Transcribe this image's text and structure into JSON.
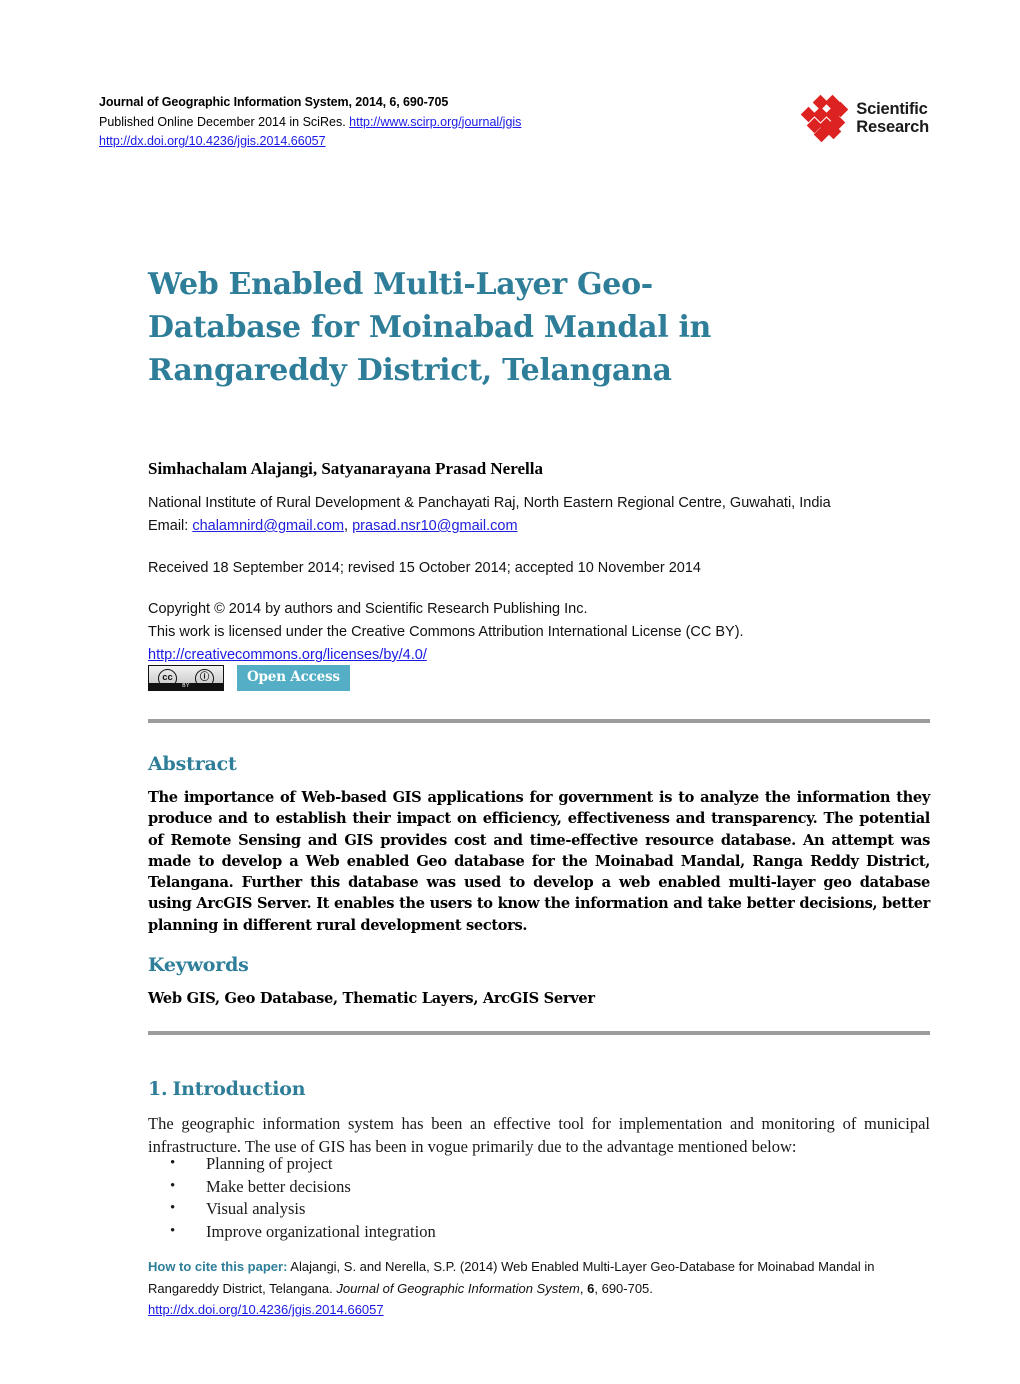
{
  "masthead": {
    "journal_line": "Journal of Geographic Information System, 2014, 6, 690-705",
    "published_prefix": "Published Online December 2014 in SciRes. ",
    "published_url": "http://www.scirp.org/journal/jgis",
    "doi_url": "http://dx.doi.org/10.4236/jgis.2014.66057",
    "logo_line1": "Scientific",
    "logo_line2": "Research",
    "logo_color": "#dd2222"
  },
  "paper": {
    "title": "Web Enabled Multi-Layer Geo-Database for Moinabad Mandal in Rangareddy District, Telangana",
    "title_color": "#2e7e99",
    "authors": "Simhachalam Alajangi, Satyanarayana Prasad Nerella",
    "affiliation": "National Institute of Rural Development & Panchayati Raj, North Eastern Regional Centre, Guwahati, India",
    "email_label": "Email: ",
    "email1": "chalamnird@gmail.com",
    "email_sep": ", ",
    "email2": "prasad.nsr10@gmail.com",
    "received": "Received 18 September 2014; revised 15 October 2014; accepted 10 November 2014",
    "copyright_line1": "Copyright © 2014 by authors and Scientific Research Publishing Inc.",
    "copyright_line2": "This work is licensed under the Creative Commons Attribution International License (CC BY).",
    "license_url": "http://creativecommons.org/licenses/by/4.0/"
  },
  "badges": {
    "cc_mark": "cc",
    "cc_by_person": "ⓘ",
    "cc_by_label": "BY",
    "open_access": "Open Access",
    "open_access_color": "#54afc6"
  },
  "abstract": {
    "heading": "Abstract",
    "text": "The importance of Web-based GIS applications for government is to analyze the information they produce and to establish their impact on efficiency, effectiveness and transparency. The potential of Remote Sensing and GIS provides cost and time-effective resource database. An attempt was made to develop a Web enabled Geo database for the Moinabad Mandal, Ranga Reddy District, Telangana. Further this database was used to develop a web enabled multi-layer geo database using ArcGIS Server. It enables the users to know the information and take better decisions, better planning in different rural development sectors."
  },
  "keywords": {
    "heading": "Keywords",
    "text": "Web GIS, Geo Database, Thematic Layers, ArcGIS Server"
  },
  "introduction": {
    "number": "1.",
    "heading": "Introduction",
    "paragraph": "The geographic information system has been an effective tool for implementation and monitoring of municipal infrastructure. The use of GIS has been in vogue primarily due to the advantage mentioned below:",
    "bullets": [
      "Planning of project",
      "Make better decisions",
      "Visual analysis",
      "Improve organizational integration"
    ]
  },
  "cite": {
    "label": "How to cite this paper:",
    "text_before_italic": " Alajangi, S. and Nerella, S.P. (2014) Web Enabled Multi-Layer Geo-Database for Moinabad Mandal in Rangareddy District, Telangana. ",
    "journal_italic": "Journal of Geographic Information System",
    "volume_sep": ", ",
    "volume": "6",
    "pages": ", 690-705.",
    "doi_url": "http://dx.doi.org/10.4236/jgis.2014.66057"
  }
}
